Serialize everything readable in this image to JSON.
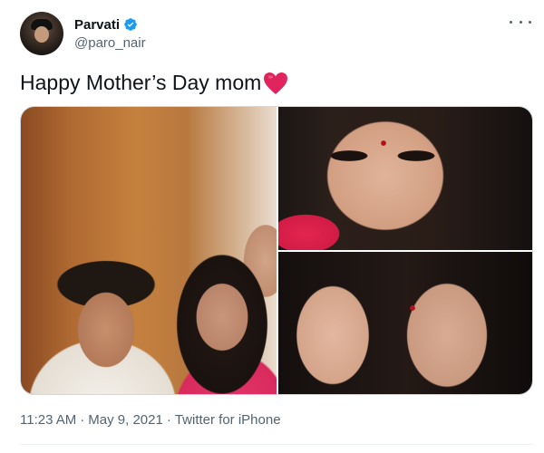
{
  "author": {
    "display_name": "Parvati",
    "handle": "@paro_nair",
    "verified": true,
    "avatar_icon": "profile-photo"
  },
  "tweet": {
    "text": "Happy Mother’s Day mom",
    "emoji_icon": "red-heart-icon"
  },
  "media": {
    "photo_count": 3
  },
  "meta": {
    "time": "11:23 AM",
    "separator": "·",
    "date": "May 9, 2021",
    "source": "Twitter for iPhone"
  },
  "colors": {
    "verified_blue": "#1d9bf0",
    "heart_red": "#e0245e",
    "secondary_text": "#536471",
    "primary_text": "#0f1419",
    "border": "#cfd9de"
  },
  "icons": {
    "more": "more-options-icon",
    "verified": "verified-badge-icon"
  }
}
